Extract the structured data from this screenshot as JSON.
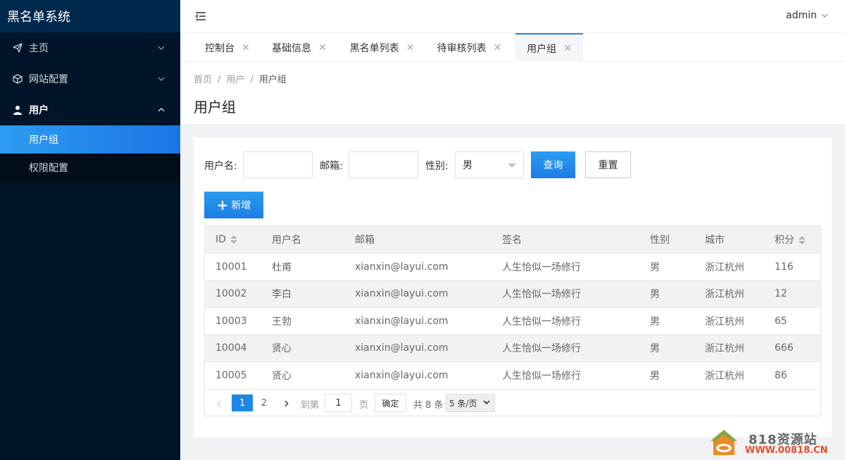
{
  "app": {
    "title": "黑名单系统"
  },
  "sidebar": {
    "items": [
      {
        "label": "主页",
        "icon": "paper-plane-icon"
      },
      {
        "label": "网站配置",
        "icon": "cube-icon"
      },
      {
        "label": "用户",
        "icon": "user-icon"
      }
    ],
    "sub_items": [
      {
        "label": "用户组",
        "active": true
      },
      {
        "label": "权限配置",
        "active": false
      }
    ]
  },
  "header": {
    "user": "admin"
  },
  "tabs": [
    {
      "label": "控制台"
    },
    {
      "label": "基础信息"
    },
    {
      "label": "黑名单列表"
    },
    {
      "label": "待审核列表"
    },
    {
      "label": "用户组",
      "active": true
    }
  ],
  "breadcrumb": [
    "首页",
    "用户",
    "用户组"
  ],
  "page_title": "用户组",
  "search": {
    "username_label": "用户名:",
    "username_value": "",
    "email_label": "邮箱:",
    "email_value": "",
    "gender_label": "性别:",
    "gender_value": "男",
    "query_button": "查询",
    "reset_button": "重置"
  },
  "add_button": "新增",
  "table": {
    "headers": [
      "ID",
      "用户名",
      "邮箱",
      "签名",
      "性别",
      "城市",
      "积分"
    ],
    "rows": [
      [
        "10001",
        "杜甫",
        "xianxin@layui.com",
        "人生恰似一场修行",
        "男",
        "浙江杭州",
        "116"
      ],
      [
        "10002",
        "李白",
        "xianxin@layui.com",
        "人生恰似一场修行",
        "男",
        "浙江杭州",
        "12"
      ],
      [
        "10003",
        "王勃",
        "xianxin@layui.com",
        "人生恰似一场修行",
        "男",
        "浙江杭州",
        "65"
      ],
      [
        "10004",
        "贤心",
        "xianxin@layui.com",
        "人生恰似一场修行",
        "男",
        "浙江杭州",
        "666"
      ],
      [
        "10005",
        "贤心",
        "xianxin@layui.com",
        "人生恰似一场修行",
        "男",
        "浙江杭州",
        "86"
      ]
    ]
  },
  "pager": {
    "prev": "‹",
    "pages": [
      "1",
      "2"
    ],
    "next": "›",
    "goto_label": "到第",
    "goto_value": "1",
    "page_suffix": "页",
    "confirm": "确定",
    "total": "共 8 条",
    "page_size": "5 条/页"
  },
  "watermark": {
    "title": "818资源站",
    "url": "WWW.00818.CN"
  },
  "colors": {
    "sidebar": "#001529",
    "accent": "#1e88e5",
    "watermark": "#e24f2a"
  }
}
